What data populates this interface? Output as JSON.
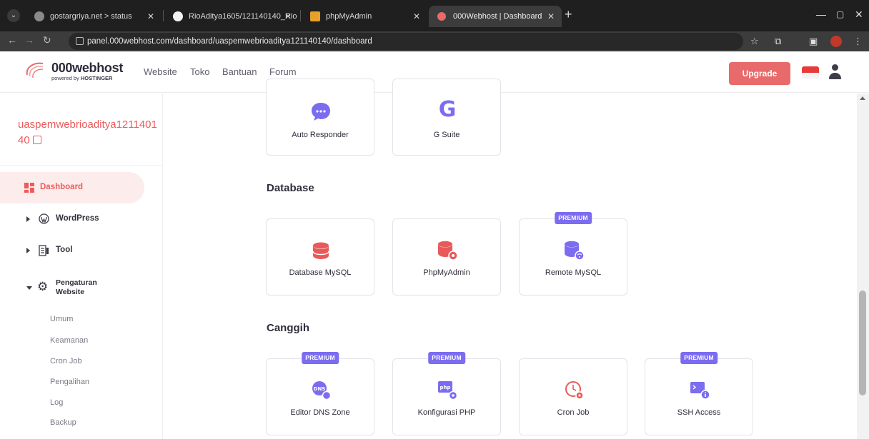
{
  "browser": {
    "tabs": [
      {
        "title": "gostargriya.net > status",
        "active": false
      },
      {
        "title": "RioAditya1605/121140140_Rio",
        "active": false
      },
      {
        "title": "phpMyAdmin",
        "active": false
      },
      {
        "title": "000Webhost | Dashboard",
        "active": true
      }
    ],
    "url": "panel.000webhost.com/dashboard/uaspemwebrioaditya121140140/dashboard"
  },
  "header": {
    "logo_title": "000webhost",
    "logo_sub_prefix": "powered by ",
    "logo_sub_brand": "HOSTINGER",
    "nav": [
      "Website",
      "Toko",
      "Bantuan",
      "Forum"
    ],
    "upgrade_label": "Upgrade"
  },
  "sidebar": {
    "site_name": "uaspemwebrioaditya121140140",
    "items": [
      {
        "label": "Dashboard",
        "icon": "dashboard-icon",
        "active": true
      },
      {
        "label": "WordPress",
        "icon": "wordpress-icon"
      },
      {
        "label": "Tool",
        "icon": "tool-icon"
      },
      {
        "label": "Pengaturan",
        "label2": "Website",
        "icon": "gear-icon"
      }
    ],
    "subitems": [
      "Umum",
      "Keamanan",
      "Cron Job",
      "Pengalihan",
      "Log",
      "Backup"
    ]
  },
  "main": {
    "top_cards": [
      {
        "label": "Auto Responder",
        "icon": "chat-bubble-icon"
      },
      {
        "label": "G Suite",
        "icon": "g-suite-icon"
      }
    ],
    "database": {
      "title": "Database",
      "cards": [
        {
          "label": "Database MySQL",
          "icon": "database-icon"
        },
        {
          "label": "PhpMyAdmin",
          "icon": "database-gear-icon"
        },
        {
          "label": "Remote MySQL",
          "icon": "database-wifi-icon",
          "badge": "PREMIUM"
        }
      ]
    },
    "advanced": {
      "title": "Canggih",
      "cards": [
        {
          "label": "Editor DNS Zone",
          "icon": "dns-icon",
          "badge": "PREMIUM"
        },
        {
          "label": "Konfigurasi PHP",
          "icon": "php-config-icon",
          "badge": "PREMIUM"
        },
        {
          "label": "Cron Job",
          "icon": "clock-gear-icon"
        },
        {
          "label": "SSH Access",
          "icon": "terminal-info-icon",
          "badge": "PREMIUM"
        }
      ]
    }
  },
  "colors": {
    "brand_red": "#e86a6a",
    "premium_purple": "#7b6cf0",
    "icon_purple": "#7b6cf0",
    "icon_red": "#e85a5a"
  }
}
